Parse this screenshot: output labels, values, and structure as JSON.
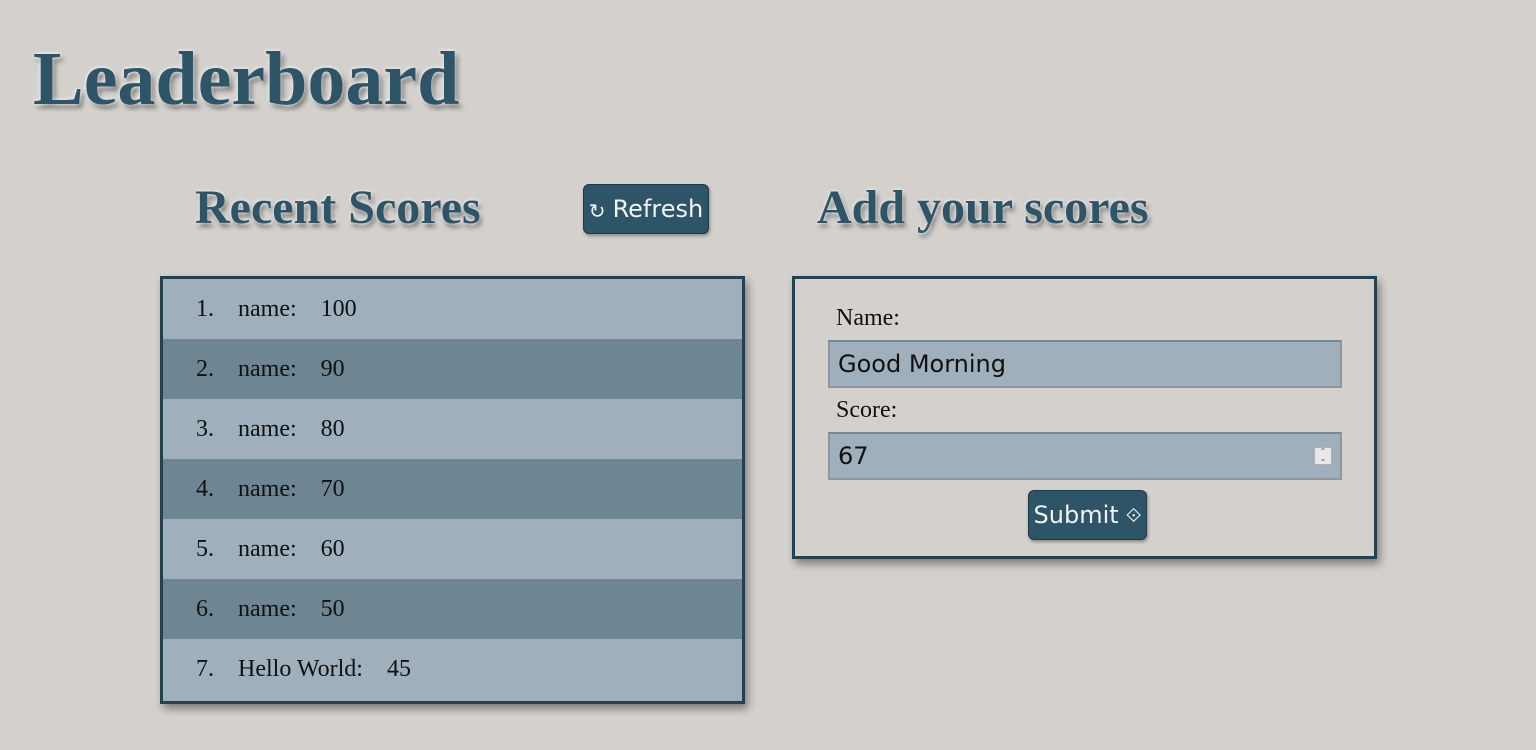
{
  "page": {
    "title": "Leaderboard"
  },
  "recent": {
    "title": "Recent Scores",
    "refresh_icon": "↻",
    "refresh_label": "Refresh",
    "scores": [
      {
        "rank": "1.",
        "name": "name:",
        "score": "100"
      },
      {
        "rank": "2.",
        "name": "name:",
        "score": "90"
      },
      {
        "rank": "3.",
        "name": "name:",
        "score": "80"
      },
      {
        "rank": "4.",
        "name": "name:",
        "score": "70"
      },
      {
        "rank": "5.",
        "name": "name:",
        "score": "60"
      },
      {
        "rank": "6.",
        "name": "name:",
        "score": "50"
      },
      {
        "rank": "7.",
        "name": "Hello World:",
        "score": "45"
      }
    ]
  },
  "form": {
    "title": "Add your scores",
    "name_label": "Name:",
    "name_value": "Good Morning",
    "score_label": "Score:",
    "score_value": "67",
    "submit_label": "Submit",
    "submit_icon": "⟐"
  },
  "colors": {
    "background": "#d4d1cd",
    "accent": "#2e5468",
    "row_light": "#9fb0bc",
    "row_dark": "#6e8593"
  }
}
